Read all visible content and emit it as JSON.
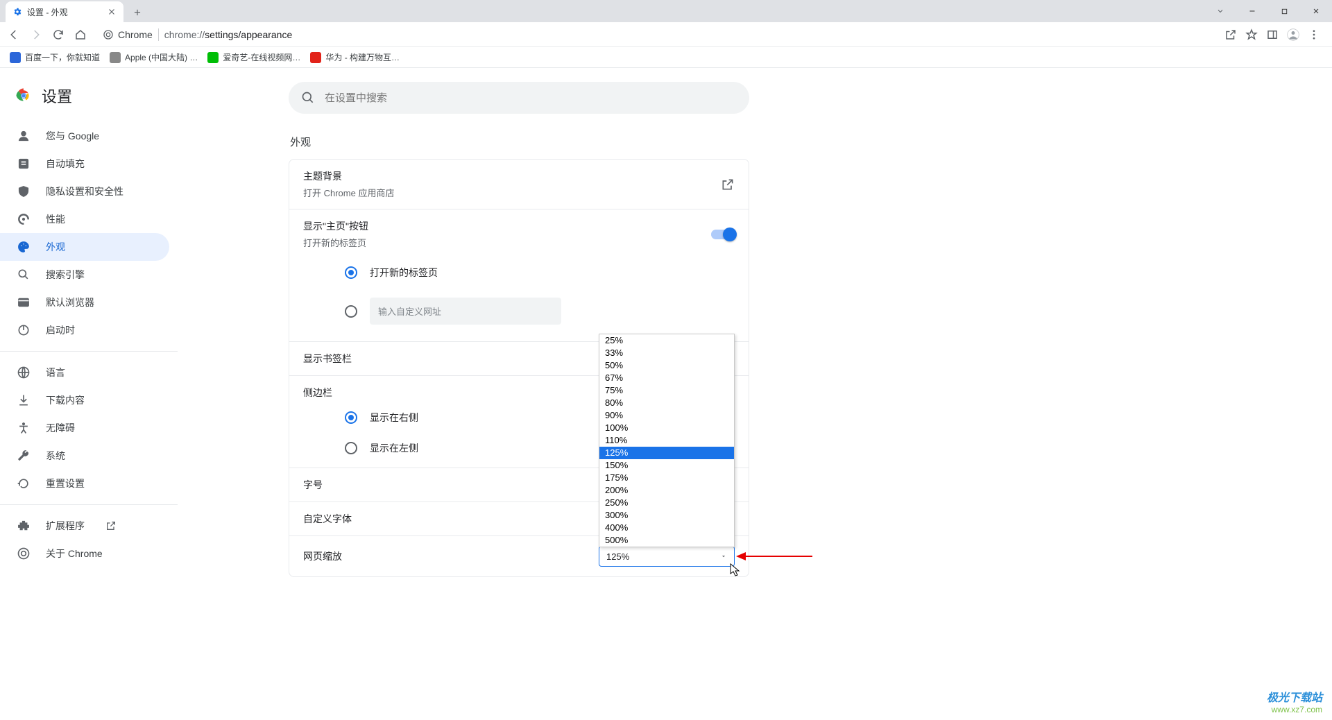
{
  "tab": {
    "title": "设置 - 外观"
  },
  "address": {
    "origin_label": "Chrome",
    "url_prefix": "chrome://",
    "url_path": "settings/appearance"
  },
  "bookmarks": [
    {
      "label": "百度一下，你就知道",
      "color": "#2b66d9"
    },
    {
      "label": "Apple (中国大陆) …",
      "color": "#888"
    },
    {
      "label": "爱奇艺-在线视频网…",
      "color": "#00be06"
    },
    {
      "label": "华为 - 构建万物互…",
      "color": "#e2231a"
    }
  ],
  "app_title": "设置",
  "sidebar": {
    "groups": [
      [
        {
          "icon": "person",
          "label": "您与 Google"
        },
        {
          "icon": "autofill",
          "label": "自动填充"
        },
        {
          "icon": "shield",
          "label": "隐私设置和安全性"
        },
        {
          "icon": "perf",
          "label": "性能"
        },
        {
          "icon": "palette",
          "label": "外观",
          "active": true
        },
        {
          "icon": "search",
          "label": "搜索引擎"
        },
        {
          "icon": "browser",
          "label": "默认浏览器"
        },
        {
          "icon": "power",
          "label": "启动时"
        }
      ],
      [
        {
          "icon": "globe",
          "label": "语言"
        },
        {
          "icon": "download",
          "label": "下载内容"
        },
        {
          "icon": "a11y",
          "label": "无障碍"
        },
        {
          "icon": "wrench",
          "label": "系统"
        },
        {
          "icon": "reset",
          "label": "重置设置"
        }
      ],
      [
        {
          "icon": "ext",
          "label": "扩展程序",
          "extlink": true
        },
        {
          "icon": "chrome",
          "label": "关于 Chrome"
        }
      ]
    ]
  },
  "search_placeholder": "在设置中搜索",
  "section_title": "外观",
  "theme": {
    "title": "主题背景",
    "sub": "打开 Chrome 应用商店"
  },
  "home_button": {
    "title": "显示\"主页\"按钮",
    "sub": "打开新的标签页",
    "radio_newtab": "打开新的标签页",
    "url_placeholder": "输入自定义网址"
  },
  "bookmarks_bar": {
    "title": "显示书签栏"
  },
  "side_panel": {
    "title": "侧边栏",
    "right": "显示在右侧",
    "left": "显示在左侧"
  },
  "font_size": {
    "title": "字号"
  },
  "custom_fonts": {
    "title": "自定义字体"
  },
  "page_zoom": {
    "title": "网页缩放",
    "value": "125%",
    "options": [
      "25%",
      "33%",
      "50%",
      "67%",
      "75%",
      "80%",
      "90%",
      "100%",
      "110%",
      "125%",
      "150%",
      "175%",
      "200%",
      "250%",
      "300%",
      "400%",
      "500%"
    ],
    "selected_index": 9
  },
  "watermark": {
    "line1": "极光下载站",
    "line2": "www.xz7.com"
  }
}
